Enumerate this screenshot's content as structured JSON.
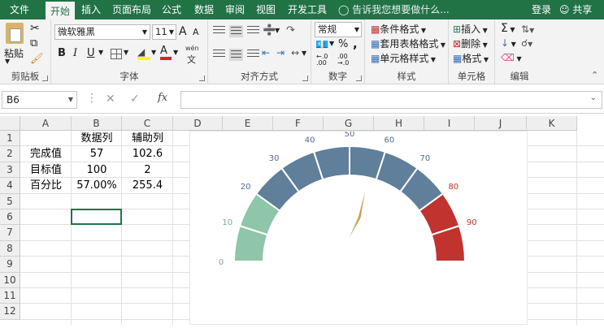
{
  "tabs": [
    "文件",
    "开始",
    "插入",
    "页面布局",
    "公式",
    "数据",
    "审阅",
    "视图",
    "开发工具"
  ],
  "tell_me": "告诉我您想要做什么...",
  "login": "登录",
  "share": "共享",
  "clipboard": {
    "paste": "粘贴",
    "group": "剪贴板"
  },
  "font": {
    "name": "微软雅黑",
    "size": "11",
    "bold": "B",
    "italic": "I",
    "underline": "U",
    "grow": "A",
    "shrink": "A",
    "phonetic": "wén",
    "font_color_letter": "A",
    "group": "字体"
  },
  "alignment": {
    "group": "对齐方式"
  },
  "number": {
    "format": "常规",
    "percent": "%",
    "comma": ",",
    "group": "数字"
  },
  "styles": {
    "conditional": "条件格式",
    "table": "套用表格格式",
    "cell": "单元格样式",
    "group": "样式"
  },
  "cells": {
    "insert": "插入",
    "delete": "删除",
    "format": "格式",
    "group": "单元格"
  },
  "editing": {
    "group": "编辑"
  },
  "formula_bar": {
    "name_box": "B6",
    "fx": "fx",
    "formula": ""
  },
  "columns": [
    "A",
    "B",
    "C",
    "D",
    "E",
    "F",
    "G",
    "H",
    "I",
    "J",
    "K"
  ],
  "rows": [
    "1",
    "2",
    "3",
    "4",
    "5",
    "6",
    "7",
    "8",
    "9",
    "10",
    "11",
    "12"
  ],
  "table": [
    [
      "",
      "数据列",
      "辅助列"
    ],
    [
      "完成值",
      "57",
      "102.6"
    ],
    [
      "目标值",
      "100",
      "2"
    ],
    [
      "百分比",
      "57.00%",
      "255.4"
    ]
  ],
  "chart_data": {
    "type": "gauge",
    "value": 57,
    "ticks": [
      "0",
      "10",
      "20",
      "30",
      "40",
      "50",
      "60",
      "70",
      "80",
      "90"
    ],
    "bands": [
      {
        "from": 0,
        "to": 20,
        "color": "#8fc5a8"
      },
      {
        "from": 20,
        "to": 80,
        "color": "#5f7f9a"
      },
      {
        "from": 80,
        "to": 100,
        "color": "#c0332f"
      }
    ],
    "needle_color": "#c9a25a",
    "tick_colors": {
      "low": "#7aa98f",
      "mid": "#4f6f8f",
      "high": "#c0332f"
    }
  }
}
